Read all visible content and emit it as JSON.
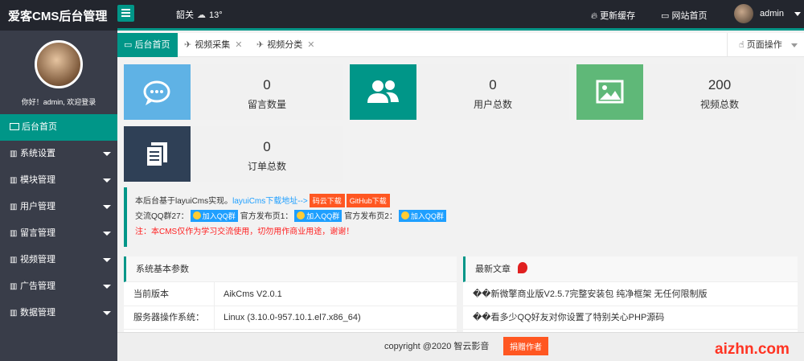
{
  "header": {
    "logo": "爱客CMS后台管理",
    "city": "韶关",
    "temperature": "13°",
    "refresh_cache": "更新缓存",
    "site_home": "网站首页",
    "username": "admin"
  },
  "sidebar": {
    "welcome": "你好！admin, 欢迎登录",
    "items": [
      {
        "label": "后台首页"
      },
      {
        "label": "系统设置"
      },
      {
        "label": "模块管理"
      },
      {
        "label": "用户管理"
      },
      {
        "label": "留言管理"
      },
      {
        "label": "视频管理"
      },
      {
        "label": "广告管理"
      },
      {
        "label": "数据管理"
      }
    ]
  },
  "tabs": {
    "items": [
      {
        "label": "后台首页"
      },
      {
        "label": "视频采集"
      },
      {
        "label": "视频分类"
      }
    ],
    "close_glyph": "✕",
    "page_ops": "页面操作"
  },
  "stats": [
    {
      "value": "0",
      "label": "留言数量",
      "color": "#5fb2e5"
    },
    {
      "value": "0",
      "label": "用户总数",
      "color": "#009688"
    },
    {
      "value": "200",
      "label": "视频总数",
      "color": "#5fb878"
    },
    {
      "value": "0",
      "label": "订单总数",
      "color": "#2f4056"
    }
  ],
  "notice": {
    "line1_prefix": "本后台基于layuiCms实现。",
    "line1_link": "layuiCms下载地址-->",
    "btn_gitee": "码云下载",
    "btn_github": "GitHub下载",
    "qq_group_label": "交流QQ群27：",
    "qq_btn": "加入QQ群",
    "official1": "官方发布页1：",
    "official2": "官方发布页2：",
    "warning": "注：本CMS仅作为学习交流使用，切勿用作商业用途，谢谢！"
  },
  "sys_panel": {
    "title": "系统基本参数",
    "rows": [
      {
        "key": "当前版本",
        "value": "AikCms V2.0.1"
      },
      {
        "key": "服务器操作系统：",
        "value": "Linux (3.10.0-957.10.1.el7.x86_64)"
      }
    ]
  },
  "news_panel": {
    "title": "最新文章",
    "items": [
      "��新微擎商业版V2.5.7完整安装包 纯净框架 无任何限制版",
      "��看多少QQ好友对你设置了特别关心PHP源码"
    ]
  },
  "footer": {
    "copyright": "copyright @2020 智云影音",
    "donate": "捐赠作者"
  },
  "watermark": "aizhn.com"
}
